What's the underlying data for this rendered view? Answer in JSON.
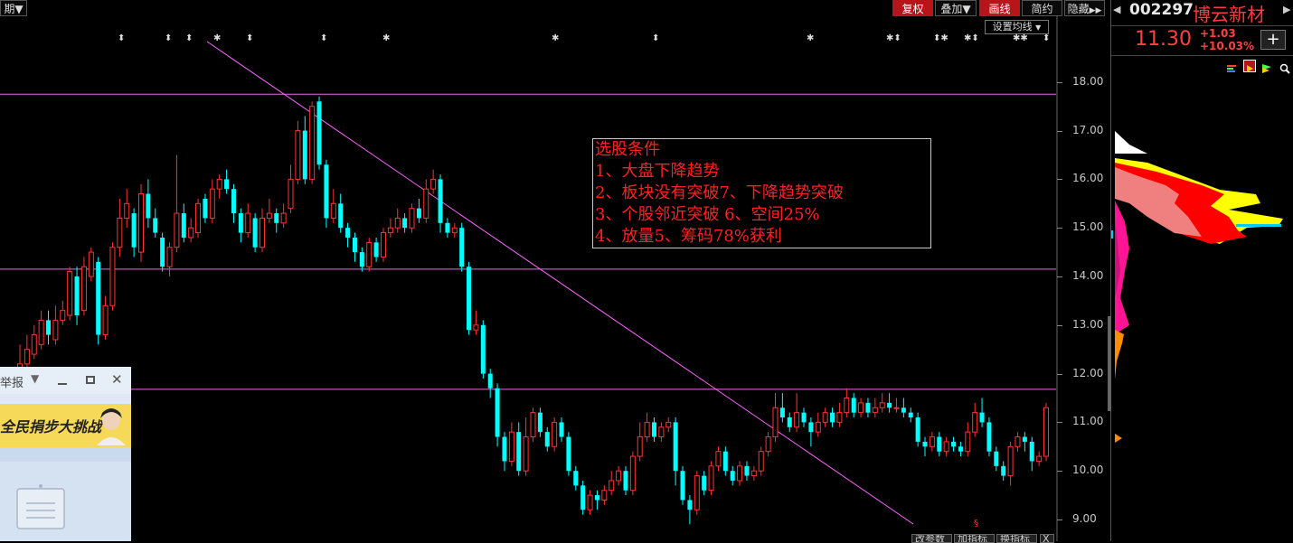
{
  "toolbar": {
    "period_label": "期",
    "period_arrow": "▼",
    "buttons": [
      {
        "label": "复权",
        "active": true
      },
      {
        "label": "叠加▼",
        "active": false
      },
      {
        "label": "画线",
        "active": true
      },
      {
        "label": "简约",
        "active": false
      },
      {
        "label": "隐藏",
        "active": false
      }
    ],
    "expand_arrows": "▶▶"
  },
  "ma_settings_label": "设置均线",
  "ma_settings_arrow": "▼",
  "stock": {
    "code": "002297",
    "name": "博云新材",
    "price": "11.30",
    "change": "+1.03",
    "change_pct": "+10.03%",
    "add_label": "+"
  },
  "y_axis": {
    "labels": [
      "18.00",
      "17.00",
      "16.00",
      "15.00",
      "14.00",
      "13.00",
      "12.00",
      "11.00",
      "10.00",
      "9.00"
    ]
  },
  "annotation": {
    "title": "选股条件",
    "lines": [
      "1、大盘下降趋势",
      "2、板块没有突破7、下降趋势突破",
      "3、个股邻近突破  6、空间25%",
      "4、放量5、筹码78%获利"
    ]
  },
  "horizontal_lines": [
    17.75,
    14.15,
    11.68
  ],
  "trend_line": {
    "from": [
      229,
      46
    ],
    "to": [
      1010,
      580
    ]
  },
  "markers": [
    "⬍",
    "⬍",
    "⬍",
    "✱",
    "⬍",
    "⬍",
    "✱",
    "✱",
    "⬍",
    "✱",
    "✱⬍",
    "⬍✱",
    "✱⬍",
    "✱✱",
    "⬍"
  ],
  "candles": [
    [
      10.5,
      12.2,
      12.6,
      10.4
    ],
    [
      12.2,
      12.5,
      12.8,
      12.0
    ],
    [
      12.4,
      12.8,
      13.0,
      12.3
    ],
    [
      12.6,
      13.1,
      13.3,
      12.5
    ],
    [
      13.1,
      12.8,
      13.3,
      12.6
    ],
    [
      12.7,
      13.1,
      13.4,
      12.6
    ],
    [
      13.1,
      13.3,
      13.5,
      13.0
    ],
    [
      13.2,
      14.1,
      14.2,
      13.1
    ],
    [
      14.0,
      13.2,
      14.2,
      13.0
    ],
    [
      13.3,
      14.2,
      14.4,
      13.2
    ],
    [
      14.0,
      14.5,
      14.6,
      13.9
    ],
    [
      14.3,
      12.8,
      14.4,
      12.6
    ],
    [
      12.8,
      13.4,
      13.6,
      12.7
    ],
    [
      13.4,
      14.6,
      14.7,
      13.3
    ],
    [
      14.6,
      15.2,
      15.6,
      14.4
    ],
    [
      15.2,
      15.5,
      15.8,
      15.0
    ],
    [
      15.3,
      14.6,
      15.4,
      14.4
    ],
    [
      14.5,
      15.7,
      15.9,
      14.3
    ],
    [
      15.7,
      15.2,
      16.0,
      15.0
    ],
    [
      15.2,
      14.9,
      15.4,
      14.8
    ],
    [
      14.8,
      14.2,
      14.9,
      14.1
    ],
    [
      14.2,
      14.6,
      14.7,
      14.0
    ],
    [
      14.6,
      15.3,
      16.5,
      14.5
    ],
    [
      15.3,
      14.8,
      15.5,
      14.7
    ],
    [
      14.8,
      15.0,
      15.2,
      14.7
    ],
    [
      14.9,
      15.5,
      15.6,
      14.8
    ],
    [
      15.6,
      15.2,
      15.7,
      15.1
    ],
    [
      15.2,
      15.8,
      16.0,
      15.1
    ],
    [
      15.8,
      16.0,
      16.1,
      15.6
    ],
    [
      16.0,
      15.8,
      16.2,
      15.7
    ],
    [
      15.8,
      15.3,
      15.9,
      15.1
    ],
    [
      15.3,
      14.9,
      15.4,
      14.7
    ],
    [
      14.9,
      15.3,
      15.5,
      14.8
    ],
    [
      15.2,
      14.6,
      15.3,
      14.5
    ],
    [
      14.6,
      15.2,
      15.4,
      14.5
    ],
    [
      15.2,
      15.3,
      15.6,
      15.1
    ],
    [
      15.3,
      15.1,
      15.4,
      14.9
    ],
    [
      15.1,
      15.3,
      15.5,
      15.0
    ],
    [
      15.4,
      16.0,
      16.3,
      15.3
    ],
    [
      16.0,
      17.0,
      17.2,
      15.9
    ],
    [
      17.0,
      16.0,
      17.3,
      15.9
    ],
    [
      16.0,
      17.5,
      17.6,
      15.9
    ],
    [
      17.6,
      16.3,
      17.7,
      16.2
    ],
    [
      16.3,
      15.2,
      16.4,
      15.0
    ],
    [
      15.2,
      15.5,
      15.8,
      15.1
    ],
    [
      15.5,
      15.0,
      15.7,
      14.9
    ],
    [
      15.0,
      14.8,
      15.1,
      14.6
    ],
    [
      14.8,
      14.5,
      14.9,
      14.3
    ],
    [
      14.5,
      14.2,
      14.6,
      14.1
    ],
    [
      14.2,
      14.7,
      14.8,
      14.1
    ],
    [
      14.7,
      14.4,
      14.8,
      14.3
    ],
    [
      14.4,
      14.9,
      15.0,
      14.3
    ],
    [
      14.9,
      15.0,
      15.2,
      14.8
    ],
    [
      15.0,
      15.2,
      15.4,
      14.9
    ],
    [
      15.2,
      15.0,
      15.3,
      14.9
    ],
    [
      15.0,
      15.4,
      15.5,
      14.9
    ],
    [
      15.4,
      15.2,
      15.6,
      15.1
    ],
    [
      15.2,
      15.8,
      16.0,
      15.1
    ],
    [
      15.8,
      16.0,
      16.2,
      15.7
    ],
    [
      16.0,
      15.1,
      16.1,
      14.9
    ],
    [
      15.1,
      14.9,
      15.2,
      14.8
    ],
    [
      14.9,
      15.0,
      15.1,
      14.8
    ],
    [
      15.0,
      14.2,
      15.1,
      14.1
    ],
    [
      14.2,
      12.9,
      14.3,
      12.8
    ],
    [
      12.9,
      13.0,
      13.3,
      12.8
    ],
    [
      13.0,
      12.0,
      13.1,
      11.9
    ],
    [
      12.0,
      11.7,
      12.1,
      11.5
    ],
    [
      11.7,
      10.7,
      11.8,
      10.5
    ],
    [
      10.7,
      10.2,
      10.8,
      10.0
    ],
    [
      10.2,
      10.8,
      11.0,
      10.1
    ],
    [
      10.8,
      10.0,
      11.0,
      9.9
    ],
    [
      10.0,
      10.7,
      11.1,
      9.9
    ],
    [
      10.7,
      11.2,
      11.3,
      10.6
    ],
    [
      11.2,
      10.8,
      11.3,
      10.7
    ],
    [
      10.8,
      10.5,
      10.9,
      10.4
    ],
    [
      10.5,
      11.0,
      11.1,
      10.4
    ],
    [
      11.0,
      10.7,
      11.1,
      10.6
    ],
    [
      10.7,
      10.0,
      10.8,
      9.9
    ],
    [
      10.0,
      9.7,
      10.1,
      9.6
    ],
    [
      9.7,
      9.2,
      9.8,
      9.1
    ],
    [
      9.2,
      9.5,
      9.6,
      9.1
    ],
    [
      9.5,
      9.4,
      9.6,
      9.2
    ],
    [
      9.4,
      9.6,
      9.7,
      9.3
    ],
    [
      9.6,
      9.8,
      10.0,
      9.5
    ],
    [
      9.8,
      10.0,
      10.1,
      9.7
    ],
    [
      10.0,
      9.6,
      10.1,
      9.5
    ],
    [
      9.6,
      10.3,
      10.4,
      9.5
    ],
    [
      10.3,
      10.7,
      11.0,
      10.2
    ],
    [
      10.7,
      11.0,
      11.2,
      10.6
    ],
    [
      11.0,
      10.7,
      11.1,
      10.6
    ],
    [
      10.7,
      10.9,
      11.0,
      10.6
    ],
    [
      10.9,
      11.0,
      11.1,
      10.8
    ],
    [
      11.0,
      10.0,
      11.1,
      9.7
    ],
    [
      10.0,
      9.4,
      10.1,
      9.3
    ],
    [
      9.4,
      9.2,
      9.5,
      8.9
    ],
    [
      9.2,
      9.9,
      10.0,
      9.1
    ],
    [
      9.9,
      9.6,
      10.0,
      9.5
    ],
    [
      9.6,
      10.1,
      10.2,
      9.5
    ],
    [
      10.1,
      10.4,
      10.5,
      10.0
    ],
    [
      10.4,
      10.0,
      10.5,
      9.9
    ],
    [
      10.0,
      9.8,
      10.1,
      9.7
    ],
    [
      9.8,
      10.1,
      10.2,
      9.7
    ],
    [
      10.1,
      9.9,
      10.2,
      9.8
    ],
    [
      9.9,
      10.0,
      10.1,
      9.8
    ],
    [
      10.0,
      10.4,
      10.5,
      9.9
    ],
    [
      10.4,
      10.7,
      10.8,
      10.3
    ],
    [
      10.7,
      11.3,
      11.6,
      10.6
    ],
    [
      11.3,
      11.1,
      11.6,
      11.0
    ],
    [
      11.1,
      10.9,
      11.2,
      10.8
    ],
    [
      10.9,
      11.2,
      11.6,
      10.8
    ],
    [
      11.2,
      11.0,
      11.3,
      10.9
    ],
    [
      11.0,
      10.8,
      11.1,
      10.5
    ],
    [
      10.8,
      11.0,
      11.2,
      10.7
    ],
    [
      11.0,
      11.2,
      11.3,
      10.9
    ],
    [
      11.2,
      11.0,
      11.3,
      10.9
    ],
    [
      11.0,
      11.2,
      11.4,
      10.9
    ],
    [
      11.2,
      11.5,
      11.7,
      11.1
    ],
    [
      11.5,
      11.2,
      11.6,
      11.1
    ],
    [
      11.2,
      11.4,
      11.5,
      11.1
    ],
    [
      11.4,
      11.2,
      11.5,
      11.1
    ],
    [
      11.2,
      11.3,
      11.5,
      11.1
    ],
    [
      11.3,
      11.4,
      11.6,
      11.2
    ],
    [
      11.4,
      11.3,
      11.6,
      11.2
    ],
    [
      11.3,
      11.3,
      11.5,
      11.2
    ],
    [
      11.3,
      11.2,
      11.5,
      11.1
    ],
    [
      11.2,
      11.1,
      11.3,
      11.0
    ],
    [
      11.1,
      10.6,
      11.2,
      10.5
    ],
    [
      10.6,
      10.5,
      10.7,
      10.3
    ],
    [
      10.5,
      10.7,
      10.8,
      10.4
    ],
    [
      10.7,
      10.4,
      10.8,
      10.3
    ],
    [
      10.4,
      10.6,
      10.7,
      10.3
    ],
    [
      10.6,
      10.5,
      10.7,
      10.4
    ],
    [
      10.5,
      10.4,
      10.6,
      10.3
    ],
    [
      10.4,
      10.8,
      11.0,
      10.3
    ],
    [
      10.8,
      11.2,
      11.4,
      10.7
    ],
    [
      11.2,
      11.0,
      11.5,
      10.9
    ],
    [
      11.0,
      10.4,
      11.1,
      10.3
    ],
    [
      10.4,
      10.1,
      10.5,
      10.0
    ],
    [
      10.1,
      9.9,
      10.2,
      9.8
    ],
    [
      9.9,
      10.5,
      10.6,
      9.7
    ],
    [
      10.5,
      10.7,
      10.8,
      10.4
    ],
    [
      10.7,
      10.6,
      10.8,
      10.4
    ],
    [
      10.6,
      10.2,
      10.7,
      10.0
    ],
    [
      10.2,
      10.3,
      10.4,
      10.1
    ],
    [
      10.3,
      11.3,
      11.4,
      10.2
    ]
  ],
  "bottom_tabs": [
    "改参数",
    "加指标",
    "换指标"
  ],
  "bottom_close": "X",
  "popup": {
    "title": "举报",
    "banner_text": "全民捐步大挑战",
    "min_icon": "▼",
    "close_icon": "✕"
  },
  "colors": {
    "up": "#ff3232",
    "down": "#00ffff",
    "trend": "#ff66ff",
    "hline": "#e070e0",
    "price_red": "#ff4040"
  }
}
